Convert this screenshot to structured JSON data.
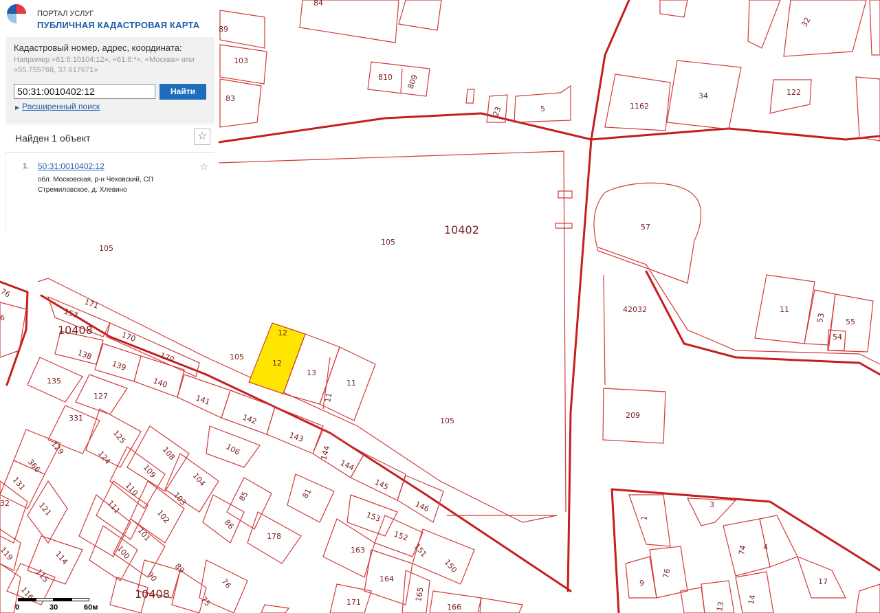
{
  "header": {
    "portal": "ПОРТАЛ УСЛУГ",
    "title": "ПУБЛИЧНАЯ КАДАСТРОВАЯ КАРТА"
  },
  "search": {
    "hint": "Кадастровый номер, адрес, координата:",
    "example": "Например «61:6:10104:12», «61:6:*», «Москва» или «55.755768, 37.617671»",
    "value": "50:31:0010402:12",
    "button": "Найти",
    "advanced": "Расширенный поиск"
  },
  "results": {
    "count_text": "Найден 1 объект",
    "items": [
      {
        "num": "1.",
        "cadastral": "50:31:0010402:12",
        "address": "обл. Московская, р-н Чеховский, СП Стремиловское, д. Хлевино"
      }
    ]
  },
  "map": {
    "colors": {
      "parcel": "#d23a3a",
      "road": "#c41e1e",
      "selected": "#ffe600"
    },
    "quarters": [
      "10402",
      "10408",
      "10408"
    ],
    "parcels": [
      "84",
      "89",
      "103",
      "83",
      "810",
      "809",
      "23",
      "5",
      "1162",
      "34",
      "122",
      "32",
      "57",
      "42032",
      "11",
      "53",
      "55",
      "54",
      "209",
      "105",
      "105",
      "105",
      "105",
      "12",
      "12",
      "13",
      "11",
      "11",
      "171",
      "157",
      "170",
      "170",
      "10408",
      "138",
      "139",
      "140",
      "141",
      "142",
      "143",
      "144",
      "144",
      "145",
      "146",
      "135",
      "127",
      "331",
      "125",
      "129",
      "124",
      "366",
      "131",
      "121",
      "32",
      "108",
      "109",
      "104",
      "110",
      "103",
      "111",
      "102",
      "101",
      "100",
      "106",
      "85",
      "86",
      "178",
      "81",
      "153",
      "152",
      "151",
      "150",
      "163",
      "164",
      "165",
      "166",
      "171",
      "114",
      "115",
      "116",
      "119",
      "90",
      "89",
      "76",
      "75",
      "1",
      "3",
      "74",
      "4",
      "9",
      "76",
      "17",
      "14",
      "13",
      "76",
      "6"
    ]
  },
  "scale": {
    "labels": [
      "0",
      "30",
      "60м"
    ]
  }
}
